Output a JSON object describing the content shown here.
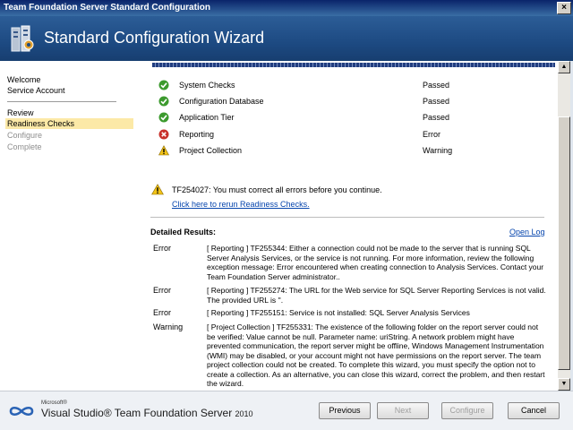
{
  "window": {
    "title": "Team Foundation Server Standard Configuration",
    "close_glyph": "×"
  },
  "header": {
    "title": "Standard Configuration Wizard"
  },
  "sidebar": {
    "items": [
      {
        "label": "Welcome",
        "state": "normal"
      },
      {
        "label": "Service Account",
        "state": "normal"
      },
      {
        "label": "Review",
        "state": "normal"
      },
      {
        "label": "Readiness Checks",
        "state": "active"
      },
      {
        "label": "Configure",
        "state": "disabled"
      },
      {
        "label": "Complete",
        "state": "disabled"
      }
    ]
  },
  "checks": [
    {
      "name": "System Checks",
      "status": "Passed",
      "icon": "success-icon"
    },
    {
      "name": "Configuration Database",
      "status": "Passed",
      "icon": "success-icon"
    },
    {
      "name": "Application Tier",
      "status": "Passed",
      "icon": "success-icon"
    },
    {
      "name": "Reporting",
      "status": "Error",
      "icon": "error-icon"
    },
    {
      "name": "Project Collection",
      "status": "Warning",
      "icon": "warning-icon"
    }
  ],
  "message": {
    "text": "TF254027: You must correct all errors before you continue.",
    "rerun_link": "Click here to rerun Readiness Checks."
  },
  "details": {
    "title": "Detailed Results:",
    "open_log": "Open Log",
    "rows": [
      {
        "type": "Error",
        "text": "[ Reporting ] TF255344: Either a connection could not be made to the server that is running SQL Server Analysis Services, or the service is not running. For more information, review the following exception message: Error encountered when creating connection to Analysis Services. Contact your Team Foundation Server administrator.."
      },
      {
        "type": "Error",
        "text": "[ Reporting ] TF255274: The URL for the Web service for SQL Server Reporting Services is not valid. The provided URL is ''."
      },
      {
        "type": "Error",
        "text": "[ Reporting ] TF255151: Service is not installed: SQL Server Analysis Services"
      },
      {
        "type": "Warning",
        "text": "[ Project Collection ] TF255331: The existence of the following folder on the report server could not be verified: Value cannot be null. Parameter name: uriString. A network problem might have prevented communication, the report server might be offline, Windows Management Instrumentation (WMI) may be disabled, or your account might not have permissions on the report server. The team project collection could not be created. To complete this wizard, you must specify the option not to create a collection. As an alternative, you can close this wizard, correct the problem, and then restart the wizard."
      }
    ]
  },
  "footer": {
    "brand_small": "Microsoft®",
    "brand_main": "Visual Studio® Team Foundation Server",
    "brand_year": "2010",
    "buttons": {
      "previous": "Previous",
      "next": "Next",
      "configure": "Configure",
      "cancel": "Cancel"
    }
  }
}
